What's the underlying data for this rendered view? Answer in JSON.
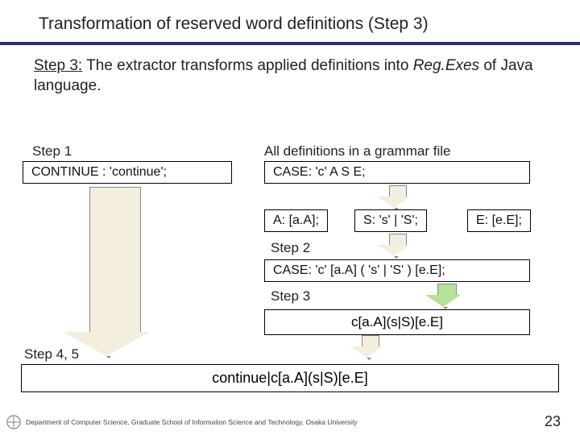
{
  "title": "Transformation of reserved word definitions (Step 3)",
  "intro": {
    "prefix": "Step 3:",
    "rest_a": " The extractor transforms applied definitions into ",
    "italic": "Reg.Exes",
    "rest_b": " of Java language."
  },
  "labels": {
    "step1": "Step 1",
    "all_defs": "All definitions in a grammar file",
    "step2": "Step 2",
    "step3": "Step 3",
    "step45": "Step 4, 5"
  },
  "boxes": {
    "continue_def": "CONTINUE : 'continue';",
    "case_def": "CASE: 'c' A S E;",
    "a_def": "A: [a.A];",
    "s_def": "S: 's' | 'S';",
    "e_def": "E: [e.E];",
    "case_expanded": "CASE: 'c' [a.A] ( 's' | 'S' ) [e.E];",
    "regex_case": "c[a.A](s|S)[e.E]",
    "regex_final": "continue|c[a.A](s|S)[e.E]"
  },
  "footer": {
    "affiliation": "Department of Computer Science, Graduate School of Information Science and Technology, Osaka University",
    "page": "23"
  }
}
